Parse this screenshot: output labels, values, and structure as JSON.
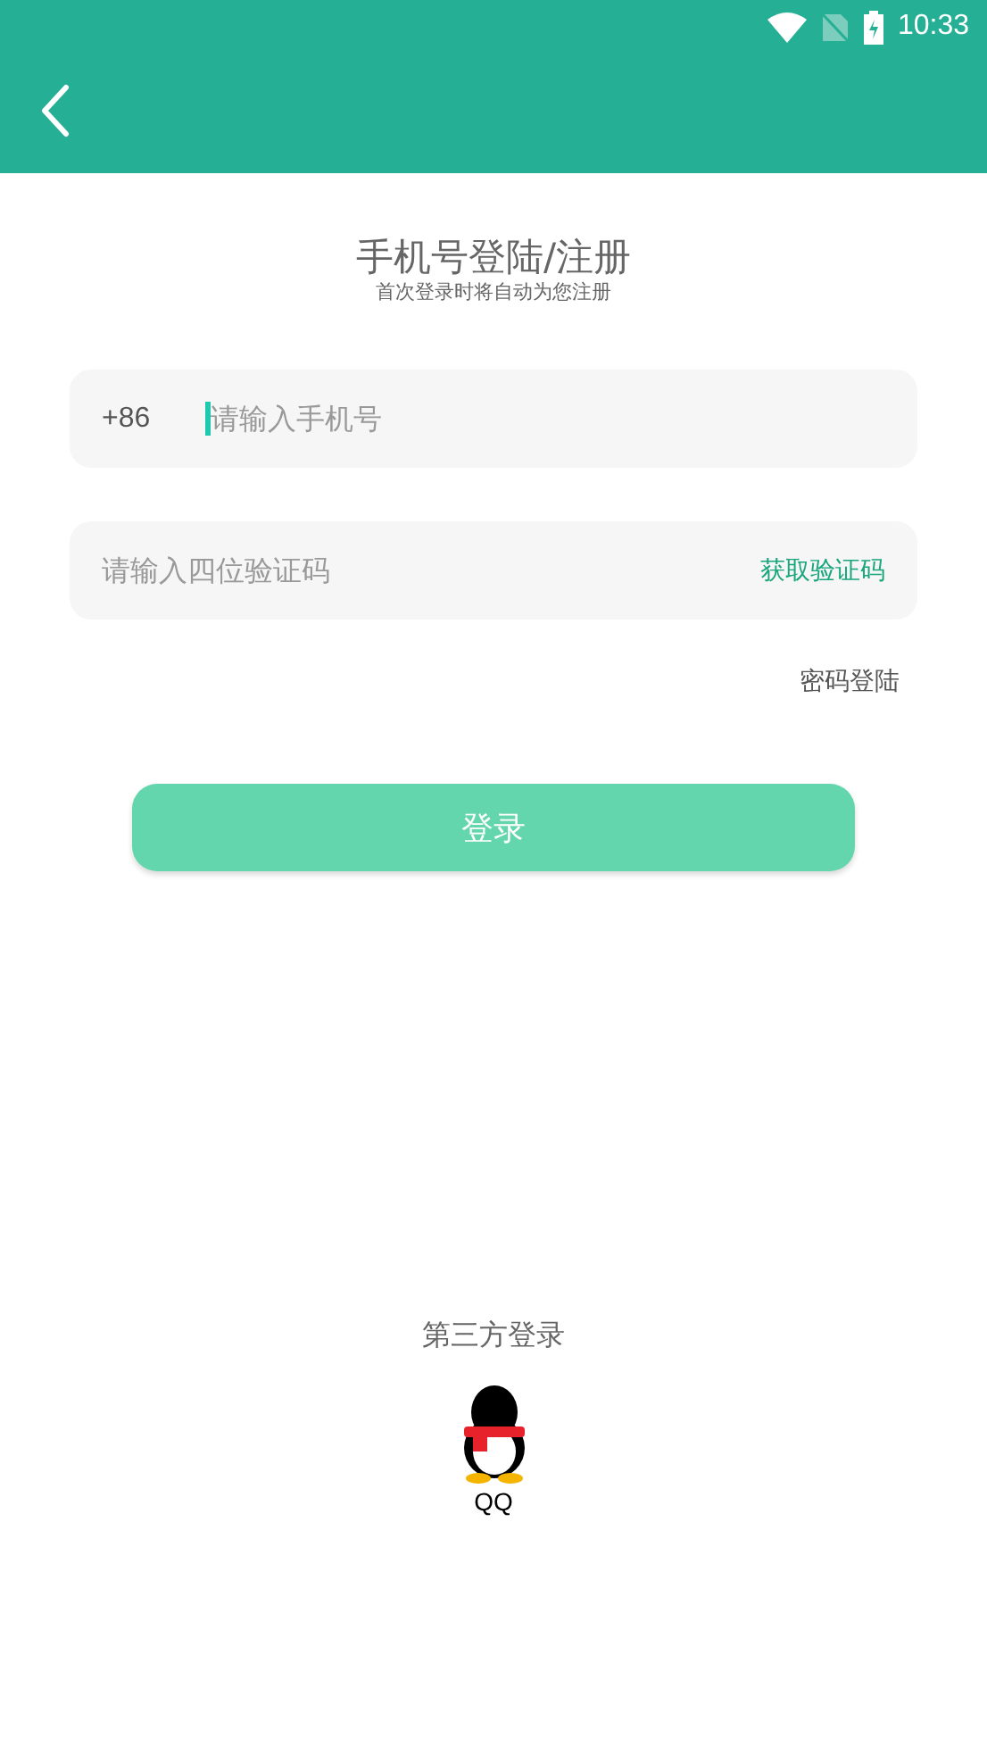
{
  "status_bar": {
    "time": "10:33"
  },
  "title": "手机号登陆/注册",
  "subtitle": "首次登录时将自动为您注册",
  "phone_field": {
    "prefix": "+86",
    "placeholder": "请输入手机号",
    "focused": true
  },
  "code_field": {
    "placeholder": "请输入四位验证码",
    "action": "获取验证码"
  },
  "password_login_link": "密码登陆",
  "login_button": {
    "label": "登录",
    "disabled": true
  },
  "third_party": {
    "title": "第三方登录",
    "providers": [
      {
        "kind": "qq",
        "label": "QQ"
      }
    ]
  }
}
